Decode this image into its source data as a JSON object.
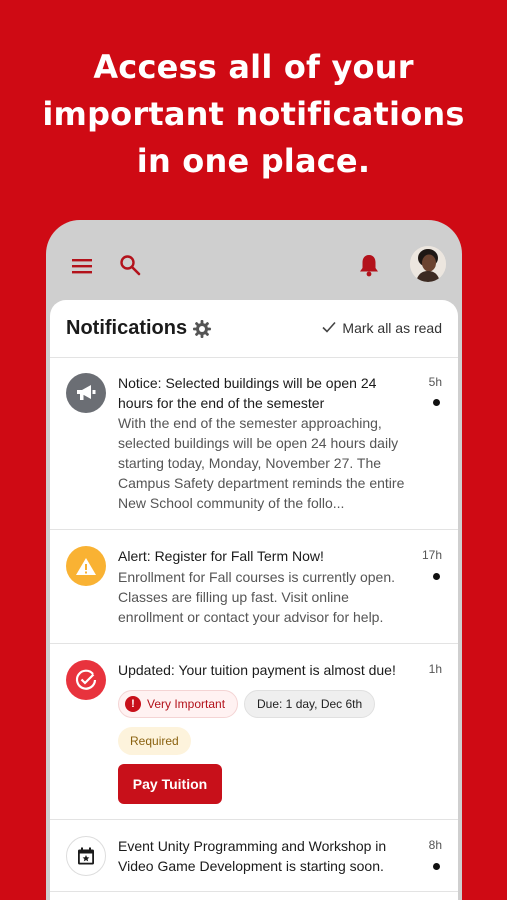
{
  "headline": {
    "line1": "Access all of your",
    "line2": "important notifications",
    "line3": "in one place."
  },
  "colors": {
    "brand_red": "#cf0a14",
    "button_red": "#c8101a",
    "alert_yellow": "#f9b233",
    "notice_gray": "#6b6e74",
    "required_bg": "#fdf3dc"
  },
  "topbar": {
    "icons": [
      "menu-icon",
      "search-icon",
      "bell-icon",
      "avatar"
    ]
  },
  "panel": {
    "title": "Notifications",
    "settings_icon": "gear-icon",
    "mark_all_label": "Mark all as read",
    "mark_all_icon": "check-icon"
  },
  "notifications": [
    {
      "icon": "megaphone-icon",
      "title": "Notice: Selected buildings will be open 24 hours for the end of the semester",
      "body": "With the end of the semester approaching, selected buildings will be open 24 hours daily starting today, Monday, November 27. The Campus Safety department reminds the entire New School community of the follo...",
      "time": "5h",
      "unread": true
    },
    {
      "icon": "warning-icon",
      "title": "Alert: Register for Fall Term Now!",
      "body": "Enrollment for Fall courses is currently open. Classes are filling up fast. Visit online enrollment or contact your advisor for help.",
      "time": "17h",
      "unread": true
    },
    {
      "icon": "check-circle-icon",
      "title": "Updated: Your tuition payment is almost due!",
      "time": "1h",
      "unread": false,
      "chips": {
        "important": "Very Important",
        "due": "Due: 1 day, Dec 6th",
        "required": "Required"
      },
      "action_label": "Pay Tuition"
    },
    {
      "icon": "calendar-icon",
      "title": "Event Unity Programming and Workshop in Video Game Development is starting soon.",
      "time": "8h",
      "unread": true
    }
  ]
}
